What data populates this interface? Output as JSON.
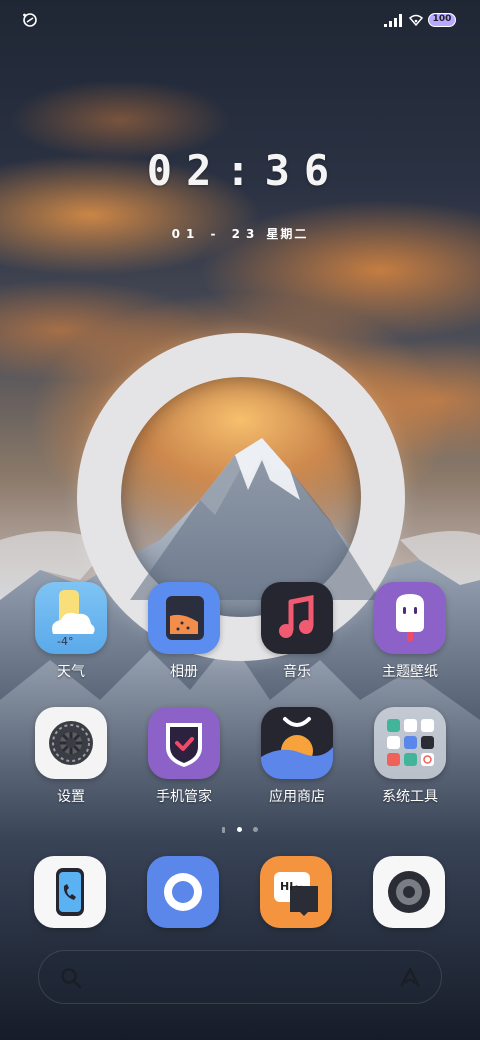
{
  "status_bar": {
    "left_icon": "vpn-icon",
    "battery": "100"
  },
  "lock": {
    "time": "02:36",
    "date": "01 - 23",
    "weekday": "星期二"
  },
  "apps_row1": [
    {
      "label": "天气",
      "icon": "weather-icon",
      "sub": "-4°"
    },
    {
      "label": "相册",
      "icon": "gallery-icon"
    },
    {
      "label": "音乐",
      "icon": "music-icon"
    },
    {
      "label": "主题壁纸",
      "icon": "theme-icon"
    }
  ],
  "apps_row2": [
    {
      "label": "设置",
      "icon": "settings-icon"
    },
    {
      "label": "手机管家",
      "icon": "phone-manager-icon"
    },
    {
      "label": "应用商店",
      "icon": "app-store-icon"
    },
    {
      "label": "系统工具",
      "icon": "system-tools-folder-icon"
    }
  ],
  "dock": [
    {
      "icon": "phone-icon"
    },
    {
      "icon": "browser-icon"
    },
    {
      "icon": "messages-icon",
      "text": "HI~"
    },
    {
      "icon": "camera-icon"
    }
  ],
  "colors": {
    "gallery_bg": "#5b8cf0",
    "theme_bg": "#8c62c8",
    "manager_bg": "#8c62c8",
    "browser_bg": "#5b86ea",
    "messages_bg": "#f5943f",
    "music_bg": "#252630"
  }
}
